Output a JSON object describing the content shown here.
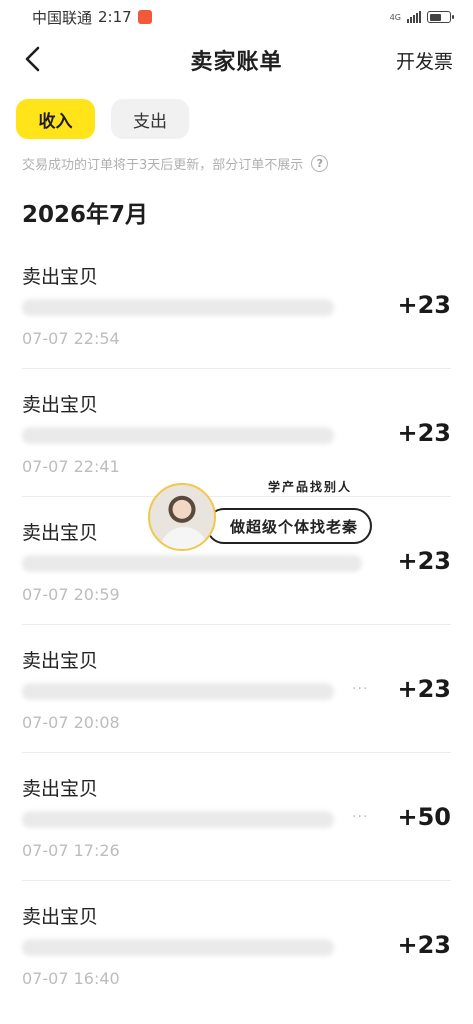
{
  "status_bar": {
    "carrier": "中国联通",
    "time": "2:17",
    "network": "4G",
    "battery_percent": 60
  },
  "nav": {
    "title": "卖家账单",
    "action": "开发票",
    "back_icon": "chevron-left-icon"
  },
  "tabs": [
    {
      "label": "收入",
      "active": true
    },
    {
      "label": "支出",
      "active": false
    }
  ],
  "notice": {
    "text": "交易成功的订单将于3天后更新，部分订单不展示",
    "help_icon": "?"
  },
  "month": "2026年7月",
  "transactions": [
    {
      "title": "卖出宝贝",
      "time": "07-07 22:54",
      "amount": "+23"
    },
    {
      "title": "卖出宝贝",
      "time": "07-07 22:41",
      "amount": "+23"
    },
    {
      "title": "卖出宝贝",
      "time": "07-07 20:59",
      "amount": "+23"
    },
    {
      "title": "卖出宝贝",
      "time": "07-07 20:08",
      "amount": "+23"
    },
    {
      "title": "卖出宝贝",
      "time": "07-07 17:26",
      "amount": "+50"
    },
    {
      "title": "卖出宝贝",
      "time": "07-07 16:40",
      "amount": "+23"
    }
  ],
  "overlay": {
    "caption": "学产品找别人",
    "pill_text": "做超级个体找老秦"
  },
  "colors": {
    "accent": "#ffe41a",
    "muted_text": "#b0b0b0"
  }
}
